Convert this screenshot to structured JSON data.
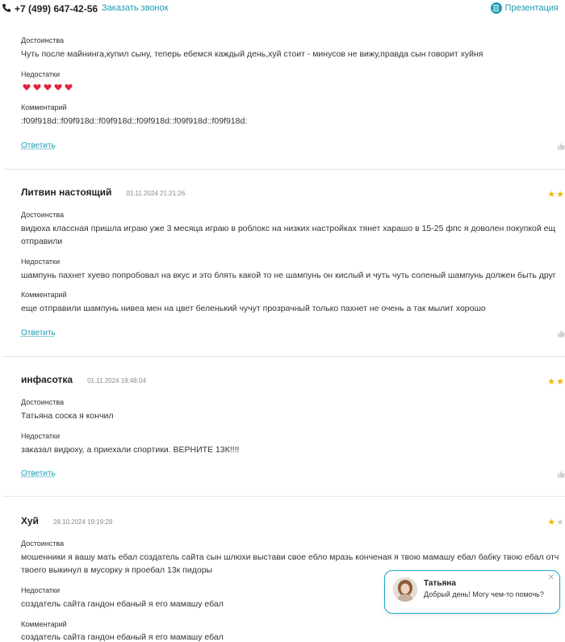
{
  "header": {
    "phone": "+7 (499) 647-42-56",
    "callback_label": "Заказать звонок",
    "presentation_label": "Презентация"
  },
  "review0": {
    "pros_label": "Достоинства",
    "pros": "Чуть после майнинга,купил сыну, теперь ебемся каждый день,хуй стоит - минусов не вижу,правда сын говорит хуйня",
    "cons_label": "Недостатки",
    "comment_label": "Комментарий",
    "comment": ":f09f918d::f09f918d::f09f918d::f09f918d::f09f918d::f09f918d:",
    "reply_label": "Ответить"
  },
  "review1": {
    "author": "Литвин настоящий",
    "date": "01.11.2024 21:21:26",
    "rating": 2,
    "pros_label": "Достоинства",
    "pros_line1": "видюха классная пришла играю уже 3 месяца играю в роблокс на низких настройках тянет харашо в 15-25 фпс я доволен покупкой ещ",
    "pros_line2": "отправили",
    "cons_label": "Недостатки",
    "cons": "шампунь пахнет хуево попробовал на вкус и это блять какой то не шампунь он кислый и чуть чуть соленый шампунь должен быть друг",
    "comment_label": "Комментарий",
    "comment": "еще отправили шампунь нивеа мен на цвет беленький чучут прозрачный только пахнет не очень а так мылит хорошо",
    "reply_label": "Ответить"
  },
  "review2": {
    "author": "инфасотка",
    "date": "01.11.2024 19:48:04",
    "rating": 2,
    "pros_label": "Достоинства",
    "pros": "Татьяна соска я кончил",
    "cons_label": "Недостатки",
    "cons": "заказал видюху, а приехали спортики. ВЕРНИТЕ 13К!!!!",
    "reply_label": "Ответить"
  },
  "review3": {
    "author": "Хуй",
    "date": "28.10.2024 19:19:28",
    "rating": 1,
    "pros_label": "Достоинства",
    "pros_line1": "мошенники я вашу мать ебал создатель сайта сын шлюхи выстави свое ебло мразь конченая я твою мамашу ебал бабку твою ебал отч",
    "pros_line2": "твоего выкинул в мусорку я проебал 13к пидоры",
    "cons_label": "Недостатки",
    "cons": "создатель сайта гандон ебаный я его мамашу ебал",
    "comment_label": "Комментарий",
    "comment": "создатель сайта гандон ебаный я его мамашу ебал"
  },
  "chat": {
    "name": "Татьяна",
    "message": "Добрый день! Могу чем-то помочь?"
  },
  "colors": {
    "accent": "#1a9bb5",
    "star": "#f4b400",
    "heart": "#e0243a"
  }
}
